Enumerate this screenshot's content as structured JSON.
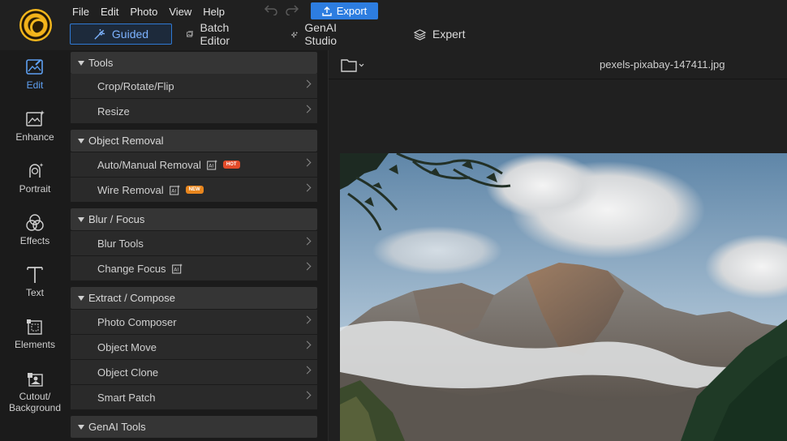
{
  "menu": [
    "File",
    "Edit",
    "Photo",
    "View",
    "Help"
  ],
  "toolbar": {
    "export_label": "Export",
    "undo_icon": "undo-icon",
    "redo_icon": "redo-icon"
  },
  "modes": {
    "guided": "Guided",
    "batch": "Batch Editor",
    "genai": "GenAI Studio",
    "expert": "Expert",
    "active": "guided"
  },
  "sidebar": {
    "items": [
      {
        "label": "Edit",
        "icon": "edit-photo-icon",
        "active": true
      },
      {
        "label": "Enhance",
        "icon": "enhance-icon"
      },
      {
        "label": "Portrait",
        "icon": "portrait-icon"
      },
      {
        "label": "Effects",
        "icon": "effects-icon"
      },
      {
        "label": "Text",
        "icon": "text-icon"
      },
      {
        "label": "Elements",
        "icon": "elements-icon"
      },
      {
        "label": "Cutout/",
        "label2": "Background",
        "icon": "cutout-icon"
      }
    ]
  },
  "panel": {
    "groups": [
      {
        "title": "Tools",
        "items": [
          "Crop/Rotate/Flip",
          "Resize"
        ]
      },
      {
        "title": "Object Removal",
        "items": [
          "Auto/Manual Removal",
          "Wire Removal"
        ]
      },
      {
        "title": "Blur / Focus",
        "items": [
          "Blur Tools",
          "Change Focus"
        ]
      },
      {
        "title": "Extract / Compose",
        "items": [
          "Photo Composer",
          "Object Move",
          "Object Clone",
          "Smart Patch"
        ]
      },
      {
        "title": "GenAI Tools",
        "items": []
      }
    ],
    "tags": {
      "hot": "HOT",
      "new": "NEW"
    }
  },
  "canvas": {
    "file_name": "pexels-pixabay-147411.jpg"
  },
  "colors": {
    "accent": "#2d7de0",
    "active_text": "#5ea0f2",
    "hot": "#e24b2a",
    "new": "#e8861e"
  }
}
